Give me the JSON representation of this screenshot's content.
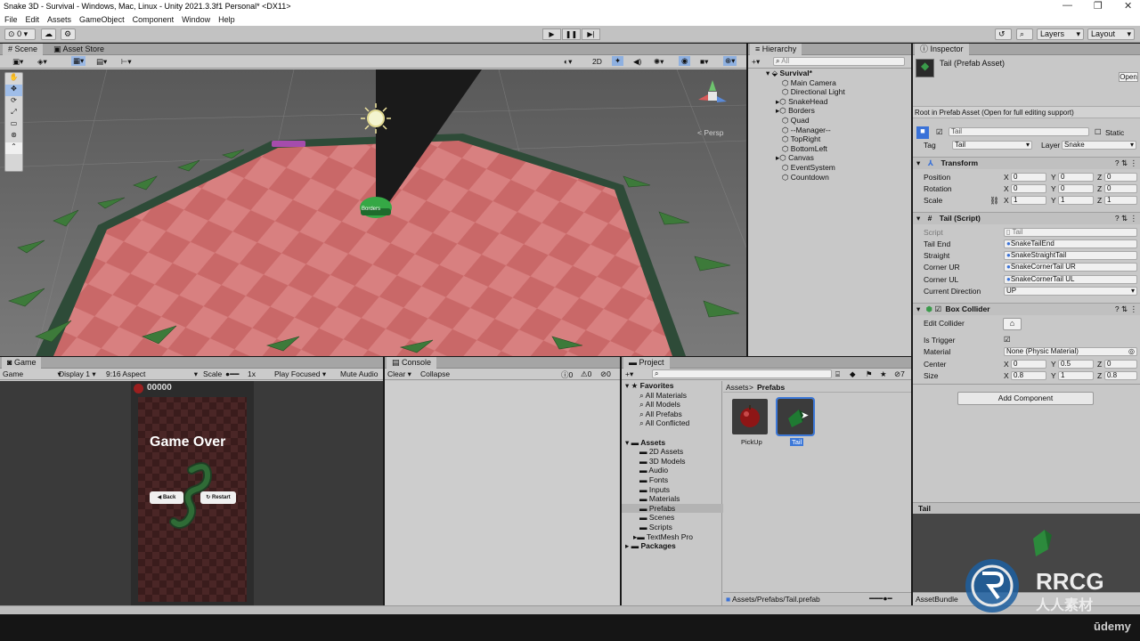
{
  "window": {
    "title": "Snake 3D - Survival - Windows, Mac, Linux - Unity 2021.3.3f1 Personal* <DX11>"
  },
  "menu": [
    "File",
    "Edit",
    "Assets",
    "GameObject",
    "Component",
    "Window",
    "Help"
  ],
  "toolbar": {
    "account_count": "0",
    "layers": "Layers",
    "layout": "Layout"
  },
  "scene": {
    "tab": "Scene",
    "asset_store_tab": "Asset Store",
    "mode_2d": "2D",
    "persp_label": "< Persp",
    "borders_label": "Borders"
  },
  "hierarchy": {
    "tab": "Hierarchy",
    "search_placeholder": "All",
    "scene_name": "Survival*",
    "items": [
      "Main Camera",
      "Directional Light",
      "SnakeHead",
      "Borders",
      "Quad",
      "--Manager--",
      "TopRight",
      "BottomLeft",
      "Canvas",
      "EventSystem",
      "Countdown"
    ]
  },
  "inspector": {
    "tab": "Inspector",
    "asset_title": "Tail (Prefab Asset)",
    "open_button": "Open",
    "root_note": "Root in Prefab Asset (Open for full editing support)",
    "name_value": "Tail",
    "static_label": "Static",
    "tag_label": "Tag",
    "tag_value": "Tail",
    "layer_label": "Layer",
    "layer_value": "Snake",
    "transform": {
      "title": "Transform",
      "position": {
        "label": "Position",
        "x": "0",
        "y": "0",
        "z": "0"
      },
      "rotation": {
        "label": "Rotation",
        "x": "0",
        "y": "0",
        "z": "0"
      },
      "scale": {
        "label": "Scale",
        "x": "1",
        "y": "1",
        "z": "1"
      }
    },
    "tail_script": {
      "title": "Tail (Script)",
      "script_label": "Script",
      "script_value": "Tail",
      "tail_end_label": "Tail End",
      "tail_end_value": "SnakeTailEnd",
      "straight_label": "Straight",
      "straight_value": "SnakeStraightTail",
      "corner_ur_label": "Corner UR",
      "corner_ur_value": "SnakeCornerTail UR",
      "corner_ul_label": "Corner UL",
      "corner_ul_value": "SnakeCornerTail UL",
      "current_direction_label": "Current Direction",
      "current_direction_value": "UP"
    },
    "box_collider": {
      "title": "Box Collider",
      "edit_collider_label": "Edit Collider",
      "is_trigger_label": "Is Trigger",
      "material_label": "Material",
      "material_value": "None (Physic Material)",
      "center_label": "Center",
      "center": {
        "x": "0",
        "y": "0.5",
        "z": "0"
      },
      "size_label": "Size",
      "size": {
        "x": "0.8",
        "y": "1",
        "z": "0.8"
      }
    },
    "add_component": "Add Component",
    "preview_title": "Tail",
    "asset_bundle_label": "AssetBundle"
  },
  "game": {
    "tab": "Game",
    "display_mode": "Game",
    "display": "Display 1",
    "aspect": "9:16 Aspect",
    "scale_label": "Scale",
    "scale_value": "1x",
    "play_focused": "Play Focused",
    "mute_audio": "Mute Audio",
    "score": "00000",
    "game_over": "Game Over",
    "back_button": "Back",
    "restart_button": "Restart"
  },
  "console": {
    "tab": "Console",
    "clear": "Clear",
    "collapse": "Collapse",
    "counts": [
      "0",
      "0",
      "0"
    ]
  },
  "project": {
    "tab": "Project",
    "hidden_count": "7",
    "favorites_label": "Favorites",
    "favorites": [
      "All Materials",
      "All Models",
      "All Prefabs",
      "All Conflicted"
    ],
    "assets_label": "Assets",
    "folders": [
      "2D Assets",
      "3D Models",
      "Audio",
      "Fonts",
      "Inputs",
      "Materials",
      "Prefabs",
      "Scenes",
      "Scripts",
      "TextMesh Pro"
    ],
    "packages_label": "Packages",
    "breadcrumb_root": "Assets",
    "breadcrumb_sep": ">",
    "breadcrumb_current": "Prefabs",
    "items": [
      {
        "name": "PickUp"
      },
      {
        "name": "Tail"
      }
    ],
    "status_path": "Assets/Prefabs/Tail.prefab"
  },
  "watermark": {
    "brand": "RRCG",
    "sub": "人人素材",
    "platform": "ūdemy"
  },
  "colors": {
    "accent": "#3a72d8",
    "selection": "#3c78d8",
    "floor": "#d46a6a"
  }
}
